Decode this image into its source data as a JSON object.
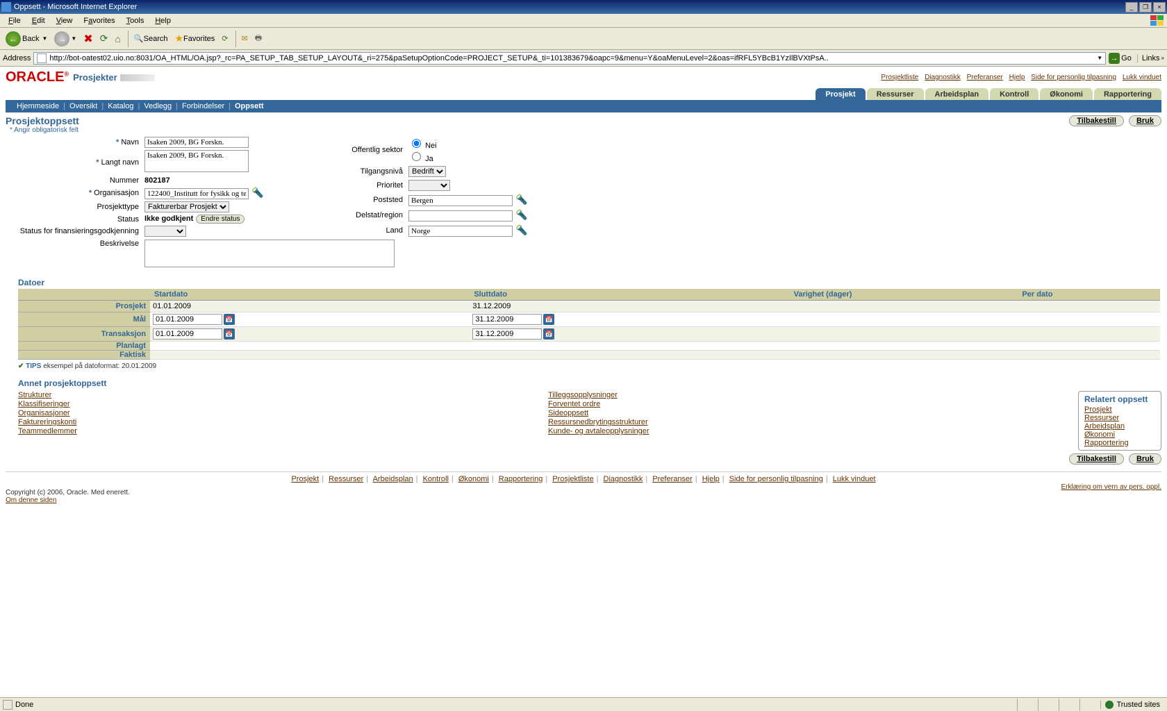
{
  "window": {
    "title": "Oppsett - Microsoft Internet Explorer"
  },
  "menu": {
    "file": "File",
    "edit": "Edit",
    "view": "View",
    "favorites": "Favorites",
    "tools": "Tools",
    "help": "Help"
  },
  "toolbar": {
    "back": "Back",
    "search": "Search",
    "favorites": "Favorites"
  },
  "address": {
    "label": "Address",
    "url": "http://bot-oatest02.uio.no:8031/OA_HTML/OA.jsp?_rc=PA_SETUP_TAB_SETUP_LAYOUT&_ri=275&paSetupOptionCode=PROJECT_SETUP&_ti=101383679&oapc=9&menu=Y&oaMenuLevel=2&oas=ifRFL5YBcB1YzIlBVXtPsA..",
    "go": "Go",
    "links": "Links"
  },
  "brand": {
    "oracle": "ORACLE",
    "module": "Prosjekter"
  },
  "toplinks": {
    "prosjektliste": "Prosjektliste",
    "diagnostikk": "Diagnostikk",
    "preferanser": "Preferanser",
    "hjelp": "Hjelp",
    "personlig": "Side for personlig tilpasning",
    "lukk": "Lukk vinduet"
  },
  "tabs": {
    "prosjekt": "Prosjekt",
    "ressurser": "Ressurser",
    "arbeidsplan": "Arbeidsplan",
    "kontroll": "Kontroll",
    "okonomi": "Økonomi",
    "rapportering": "Rapportering"
  },
  "subnav": {
    "hjemmeside": "Hjemmeside",
    "oversikt": "Oversikt",
    "katalog": "Katalog",
    "vedlegg": "Vedlegg",
    "forbindelser": "Forbindelser",
    "oppsett": "Oppsett"
  },
  "page_title": "Prosjektoppsett",
  "req_note": "Angir obligatorisk felt",
  "buttons": {
    "tilbakestill": "Tilbakestill",
    "bruk": "Bruk",
    "endre_status": "Endre status"
  },
  "fields": {
    "navn": {
      "label": "Navn",
      "value": "Isaken 2009, BG Forskn."
    },
    "langt_navn": {
      "label": "Langt navn",
      "value": "Isaken 2009, BG Forskn."
    },
    "nummer": {
      "label": "Nummer",
      "value": "802187"
    },
    "organisasjon": {
      "label": "Organisasjon",
      "value": "122400_Institutt for fysikk og te"
    },
    "prosjekttype": {
      "label": "Prosjekttype",
      "value": "Fakturerbar Prosjekt"
    },
    "status": {
      "label": "Status",
      "value": "Ikke godkjent"
    },
    "fin_status": {
      "label": "Status for finansieringsgodkjenning"
    },
    "beskrivelse": {
      "label": "Beskrivelse"
    },
    "offentlig": {
      "label": "Offentlig sektor",
      "nei": "Nei",
      "ja": "Ja"
    },
    "tilgang": {
      "label": "Tilgangsnivå",
      "value": "Bedrift"
    },
    "prioritet": {
      "label": "Prioritet"
    },
    "poststed": {
      "label": "Poststed",
      "value": "Bergen"
    },
    "delstat": {
      "label": "Delstat/region"
    },
    "land": {
      "label": "Land",
      "value": "Norge"
    }
  },
  "dates": {
    "section": "Datoer",
    "cols": {
      "start": "Startdato",
      "slutt": "Sluttdato",
      "varighet": "Varighet (dager)",
      "per": "Per dato"
    },
    "rows": {
      "prosjekt": {
        "label": "Prosjekt",
        "start": "01.01.2009",
        "slutt": "31.12.2009"
      },
      "mal": {
        "label": "Mål",
        "start": "01.01.2009",
        "slutt": "31.12.2009"
      },
      "transaksjon": {
        "label": "Transaksjon",
        "start": "01.01.2009",
        "slutt": "31.12.2009"
      },
      "planlagt": {
        "label": "Planlagt"
      },
      "faktisk": {
        "label": "Faktisk"
      }
    },
    "tips_label": "TIPS",
    "tips_text": "eksempel på datoformat: 20.01.2009"
  },
  "other": {
    "section": "Annet prosjektoppsett",
    "col1": {
      "strukturer": "Strukturer",
      "klassifiseringer": "Klassifiseringer",
      "organisasjoner": "Organisasjoner",
      "faktureringskonti": "Faktureringskonti",
      "teammedlemmer": "Teammedlemmer"
    },
    "col2": {
      "tillegg": "Tilleggsopplysninger",
      "forventet": "Forventet ordre",
      "sideoppsett": "Sideoppsett",
      "ressursned": "Ressursnedbrytingsstrukturer",
      "kunde": "Kunde- og avtaleopplysninger"
    },
    "related": {
      "title": "Relatert oppsett",
      "prosjekt": "Prosjekt",
      "ressurser": "Ressurser",
      "arbeidsplan": "Arbeidsplan",
      "okonomi": "Økonomi",
      "rapportering": "Rapportering"
    }
  },
  "footer": {
    "copyright": "Copyright (c) 2006, Oracle. Med enerett.",
    "about": "Om denne siden",
    "privacy": "Erklæring om vern av pers. oppl."
  },
  "status": {
    "done": "Done",
    "trusted": "Trusted sites"
  }
}
